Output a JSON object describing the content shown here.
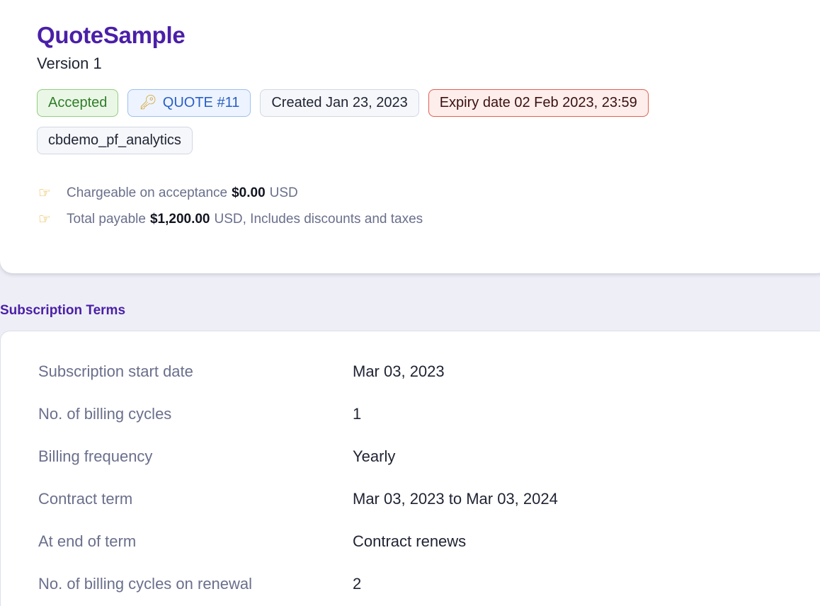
{
  "quote": {
    "title": "QuoteSample",
    "version": "Version 1",
    "badges": {
      "status": "Accepted",
      "quote_icon": "key-icon",
      "quote_number": "QUOTE #11",
      "created": "Created Jan 23, 2023",
      "expiry": "Expiry date 02 Feb 2023, 23:59",
      "site": "cbdemo_pf_analytics"
    },
    "summary": [
      {
        "icon": "pointing-hand-icon",
        "label": "Chargeable on acceptance",
        "amount": "$0.00",
        "suffix": "USD"
      },
      {
        "icon": "pointing-hand-icon",
        "label": "Total payable",
        "amount": "$1,200.00",
        "suffix": "USD, Includes discounts and taxes"
      }
    ]
  },
  "subscription_terms": {
    "heading": "Subscription Terms",
    "rows": [
      {
        "label": "Subscription start date",
        "value": "Mar 03, 2023"
      },
      {
        "label": "No. of billing cycles",
        "value": "1"
      },
      {
        "label": "Billing frequency",
        "value": "Yearly"
      },
      {
        "label": "Contract term",
        "value": "Mar 03, 2023 to Mar 03, 2024"
      },
      {
        "label": "At end of term",
        "value": "Contract renews"
      },
      {
        "label": "No. of billing cycles on renewal",
        "value": "2"
      }
    ]
  },
  "colors": {
    "title": "#4a1fa8",
    "accepted": "#2f7d2a",
    "quote": "#2a5fc4",
    "expiry_border": "#e0614f"
  }
}
